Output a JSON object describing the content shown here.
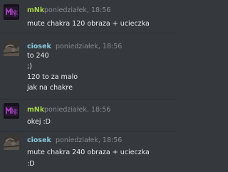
{
  "colors": {
    "background": "#35393e",
    "author_mnk": "#a4cf49",
    "author_ciosek": "#87c6d9",
    "timestamp": "#878a8f",
    "text": "#e8e9ea"
  },
  "messages": [
    {
      "author": "mNk",
      "avatar": "mnk-avatar-icon",
      "timestamp": "poniedziałek, 18:56",
      "lines": [
        "mute chakra 120 obraza + ucieczka"
      ]
    },
    {
      "author": "ciosek",
      "avatar": "ciosek-avatar-icon",
      "timestamp": "poniedziałek, 18:56",
      "lines": [
        "to 240",
        ";)",
        "120 to za malo",
        "jak na chakre"
      ]
    },
    {
      "author": "mNk",
      "avatar": "mnk-avatar-icon",
      "timestamp": "poniedziałek, 18:56",
      "lines": [
        "okej :D"
      ]
    },
    {
      "author": "ciosek",
      "avatar": "ciosek-avatar-icon",
      "timestamp": "poniedziałek, 18:56",
      "lines": [
        "mute chakra 240 obraza + ucieczka",
        ":D"
      ]
    }
  ]
}
